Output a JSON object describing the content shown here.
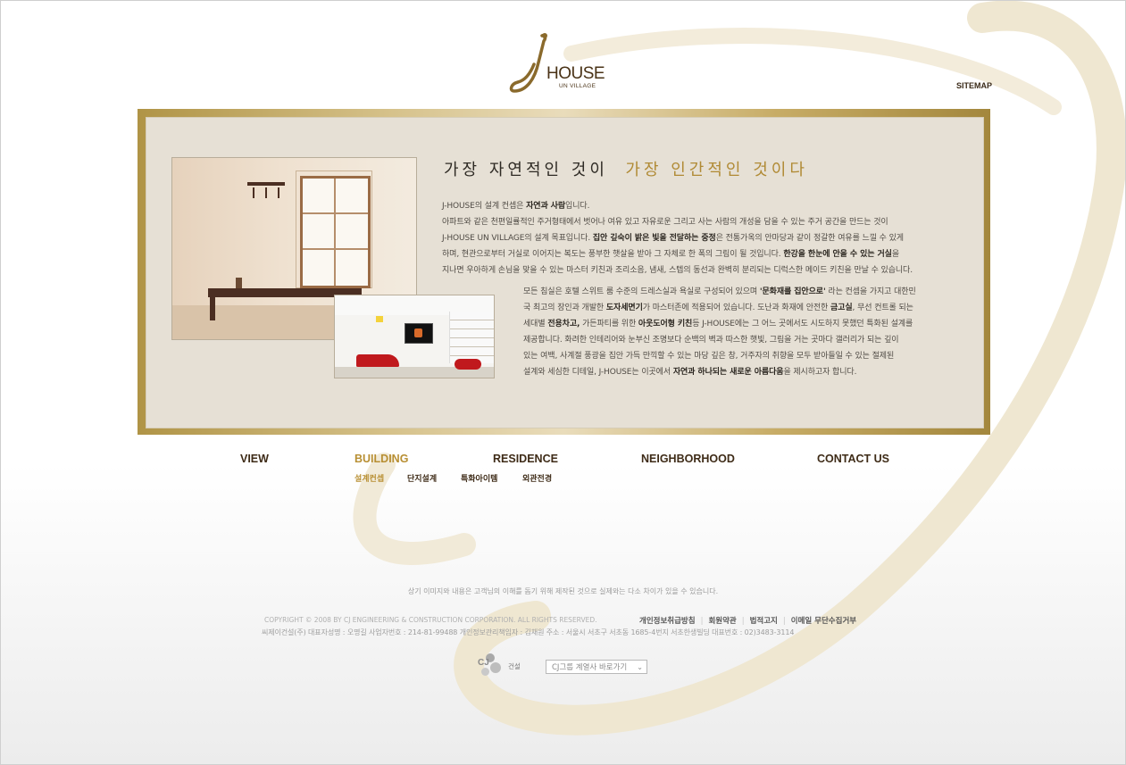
{
  "brand": {
    "logo_letter": "j",
    "logo_house": "HOUSE",
    "logo_sub": "UN VILLAGE",
    "sitemap_label": "SITEMAP"
  },
  "content": {
    "headline_part1": "가장 자연적인 것이",
    "headline_part2": "가장 인간적인 것이다",
    "paragraph1": [
      [
        "J-HOUSE의 설계 컨셉은 ",
        {
          "b": "자연과 사람"
        },
        "입니다."
      ],
      [
        "아파트와 같은 천편일률적인 주거형태에서 벗어나 여유 있고 자유로운 그리고 사는 사람의 개성을 담을 수 있는 주거 공간을 만드는 것이"
      ],
      [
        "J-HOUSE UN VILLAGE의 설계 목표입니다. ",
        {
          "b": "집안 깊숙이 밝은 빛을 전달하는 중정"
        },
        "은 전통가옥의 안마당과 같이 정갈한 여유를 느낄 수 있게"
      ],
      [
        "하며, 현관으로부터 거실로 이어지는 복도는 풍부한 햇살을 받아 그 자체로 한 폭의 그림이 될 것입니다. ",
        {
          "b": "한강을 한눈에 안을 수 있는 거실"
        },
        "을"
      ],
      [
        "지나면 우아하게 손님을 맞을 수 있는 마스터 키친과 조리소음, 냄새, 스텝의 동선과 완벽히 분리되는 디럭스한 메이드 키친을 만날 수 있습니다."
      ]
    ],
    "paragraph2": [
      [
        "모든 침실은 호텔 스위트 룸 수준의 드레스실과 욕실로 구성되어 있으며 ",
        {
          "b": "'문화재를 집안으로'"
        },
        " 라는 컨셉을 가지고 대한민"
      ],
      [
        "국 최고의 장인과 개발한 ",
        {
          "b": "도자세면기"
        },
        "가 마스터존에 적용되어 있습니다. 도난과 화재에 안전한 ",
        {
          "b": "금고실"
        },
        ", 무선 컨트롤 되는"
      ],
      [
        "세대별 ",
        {
          "b": "전용차고,"
        },
        " 가든파티를 위한 ",
        {
          "b": "아웃도어형 키친"
        },
        "등 J-HOUSE에는 그 어느 곳에서도 시도하지 못했던 특화된 설계를"
      ],
      [
        "제공합니다. 화려한 인테리어와 눈부신 조명보다 순백의 벽과 따스한 햇빛, 그림을 거는 곳마다 갤러리가 되는 깊이"
      ],
      [
        "있는 여백, 사계절 풍광을 집안 가득 만끽할 수 있는 마당 깊은 창, 거주자의 취향을 모두 받아들일 수 있는 절제된"
      ],
      [
        "설계와 세심한 디테일, J-HOUSE는 이곳에서 ",
        {
          "b": "자연과 하나되는 새로운 아름다움"
        },
        "을 제시하고자 합니다."
      ]
    ]
  },
  "nav": {
    "view": "VIEW",
    "building": "BUILDING",
    "residence": "RESIDENCE",
    "neighborhood": "NEIGHBORHOOD",
    "contact": "CONTACT US",
    "building_sub": [
      "설계컨셉",
      "단지설계",
      "특화아이템",
      "외관전경"
    ]
  },
  "footer": {
    "disclaimer": "상기 이미지와 내용은 고객님의 이해를 돕기 위해 제작된 것으로 실제와는 다소 차이가 있을 수 있습니다.",
    "copyright": "COPYRIGHT © 2008 BY CJ ENGINEERING & CONSTRUCTION CORPORATION. ALL RIGHTS RESERVED.",
    "links": [
      "개인정보취급방침",
      "회원약관",
      "법적고지",
      "이메일 무단수집거부"
    ],
    "company_info": "씨제이건설(주)   대표자성명 : 오명길   사업자번호 : 214-81-99488   개인정보관리책임자 : 김채원   주소 : 서울시 서초구 서초동 1685-4번지 서초한생빌딩   대표번호 : 02)3483-3114",
    "cj_logo_text": "CJ",
    "cj_logo_name": "건설",
    "affiliate_select": "CJ그룹 계열사 바로가기"
  },
  "colors": {
    "gold": "#b08a34",
    "frame_gold": "#b09446",
    "panel_bg": "#e6e0d5",
    "nav_text": "#3e2b17"
  },
  "icons": {
    "select_arrow": "chevron-down-icon"
  }
}
